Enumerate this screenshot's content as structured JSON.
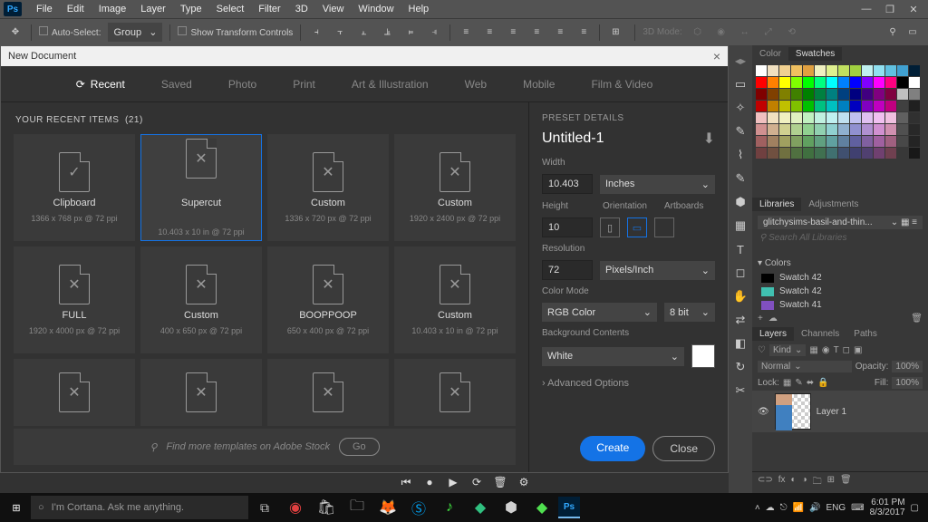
{
  "menubar": {
    "items": [
      "File",
      "Edit",
      "Image",
      "Layer",
      "Type",
      "Select",
      "Filter",
      "3D",
      "View",
      "Window",
      "Help"
    ]
  },
  "options": {
    "autoSelect": "Auto-Select:",
    "group": "Group",
    "showTransform": "Show Transform Controls",
    "mode3d": "3D Mode:"
  },
  "dialog": {
    "title": "New Document",
    "tabs": [
      "Recent",
      "Saved",
      "Photo",
      "Print",
      "Art & Illustration",
      "Web",
      "Mobile",
      "Film & Video"
    ],
    "activeTab": 0,
    "recentHeader": "YOUR RECENT ITEMS",
    "recentCount": "(21)",
    "cards": [
      {
        "name": "Clipboard",
        "sub": "1366 x 768 px @ 72 ppi",
        "clip": true
      },
      {
        "name": "Supercut",
        "sub": "10.403 x 10 in @ 72 ppi",
        "sel": true
      },
      {
        "name": "Custom",
        "sub": "1336 x 720 px @ 72 ppi"
      },
      {
        "name": "Custom",
        "sub": "1920 x 2400 px @ 72 ppi"
      },
      {
        "name": "FULL",
        "sub": "1920 x 4000 px @ 72 ppi"
      },
      {
        "name": "Custom",
        "sub": "400 x 650 px @ 72 ppi"
      },
      {
        "name": "BOOPPOOP",
        "sub": "650 x 400 px @ 72 ppi"
      },
      {
        "name": "Custom",
        "sub": "10.403 x 10 in @ 72 ppi"
      }
    ],
    "extraRow": 4,
    "stockText": "Find more templates on Adobe Stock",
    "goLabel": "Go",
    "details": {
      "header": "PRESET DETAILS",
      "name": "Untitled-1",
      "widthLabel": "Width",
      "widthVal": "10.403",
      "widthUnit": "Inches",
      "heightLabel": "Height",
      "heightVal": "10",
      "orientLabel": "Orientation",
      "artboardsLabel": "Artboards",
      "resLabel": "Resolution",
      "resVal": "72",
      "resUnit": "Pixels/Inch",
      "colorLabel": "Color Mode",
      "colorVal": "RGB Color",
      "bitVal": "8 bit",
      "bgLabel": "Background Contents",
      "bgVal": "White",
      "advanced": "Advanced Options",
      "createLabel": "Create",
      "closeLabel": "Close"
    }
  },
  "panels": {
    "colorTabs": [
      "Color",
      "Swatches"
    ],
    "libTabs": [
      "Libraries",
      "Adjustments"
    ],
    "libName": "glitchysims-basil-and-thin...",
    "libSearch": "Search All Libraries",
    "colorsHdr": "Colors",
    "swList": [
      {
        "c": "#000000",
        "n": "Swatch 42"
      },
      {
        "c": "#40c0b0",
        "n": "Swatch 42"
      },
      {
        "c": "#8050c0",
        "n": "Swatch 41"
      }
    ],
    "layerTabs": [
      "Layers",
      "Channels",
      "Paths"
    ],
    "kind": "Kind",
    "normal": "Normal",
    "opacity": "Opacity:",
    "opVal": "100%",
    "lock": "Lock:",
    "fill": "Fill:",
    "fillVal": "100%",
    "layerName": "Layer 1"
  },
  "taskbar": {
    "cortana": "I'm Cortana. Ask me anything.",
    "lang": "ENG",
    "time": "6:01 PM",
    "date": "8/3/2017"
  },
  "swatchColors": [
    "#fff",
    "#f0e0c0",
    "#f0d090",
    "#f0c060",
    "#e0a040",
    "#f0f0c0",
    "#e0f090",
    "#c0e060",
    "#a0d040",
    "#c0f0f0",
    "#90e0f0",
    "#60c0e0",
    "#40a0d0",
    "#001e36",
    "#f00",
    "#ff8000",
    "#ff0",
    "#80ff00",
    "#0f0",
    "#00ff80",
    "#0ff",
    "#0080ff",
    "#00f",
    "#8000ff",
    "#f0f",
    "#ff0080",
    "#000",
    "#fff",
    "#800000",
    "#804000",
    "#808000",
    "#408000",
    "#008000",
    "#008040",
    "#008080",
    "#004080",
    "#000080",
    "#400080",
    "#800080",
    "#800040",
    "#c0c0c0",
    "#808080",
    "#c00000",
    "#c08000",
    "#c0c000",
    "#80c000",
    "#00c000",
    "#00c080",
    "#00c0c0",
    "#0080c0",
    "#0000c0",
    "#8000c0",
    "#c000c0",
    "#c00080",
    "#404040",
    "#202020",
    "#f0c0c0",
    "#f0e0c0",
    "#f0f0c0",
    "#e0f0c0",
    "#c0f0c0",
    "#c0f0e0",
    "#c0f0f0",
    "#c0e0f0",
    "#c0c0f0",
    "#e0c0f0",
    "#f0c0f0",
    "#f0c0e0",
    "#606060",
    "#303030",
    "#d09090",
    "#d0b090",
    "#d0d090",
    "#b0d090",
    "#90d090",
    "#90d0b0",
    "#90d0d0",
    "#90b0d0",
    "#9090d0",
    "#b090d0",
    "#d090d0",
    "#d090b0",
    "#505050",
    "#282828",
    "#a06060",
    "#a08060",
    "#a0a060",
    "#80a060",
    "#60a060",
    "#60a080",
    "#60a0a0",
    "#6080a0",
    "#6060a0",
    "#8060a0",
    "#a060a0",
    "#a06080",
    "#484848",
    "#242424",
    "#704040",
    "#705040",
    "#707040",
    "#507040",
    "#407040",
    "#407050",
    "#407070",
    "#405070",
    "#404070",
    "#504070",
    "#704070",
    "#704050",
    "#383838",
    "#181818"
  ]
}
